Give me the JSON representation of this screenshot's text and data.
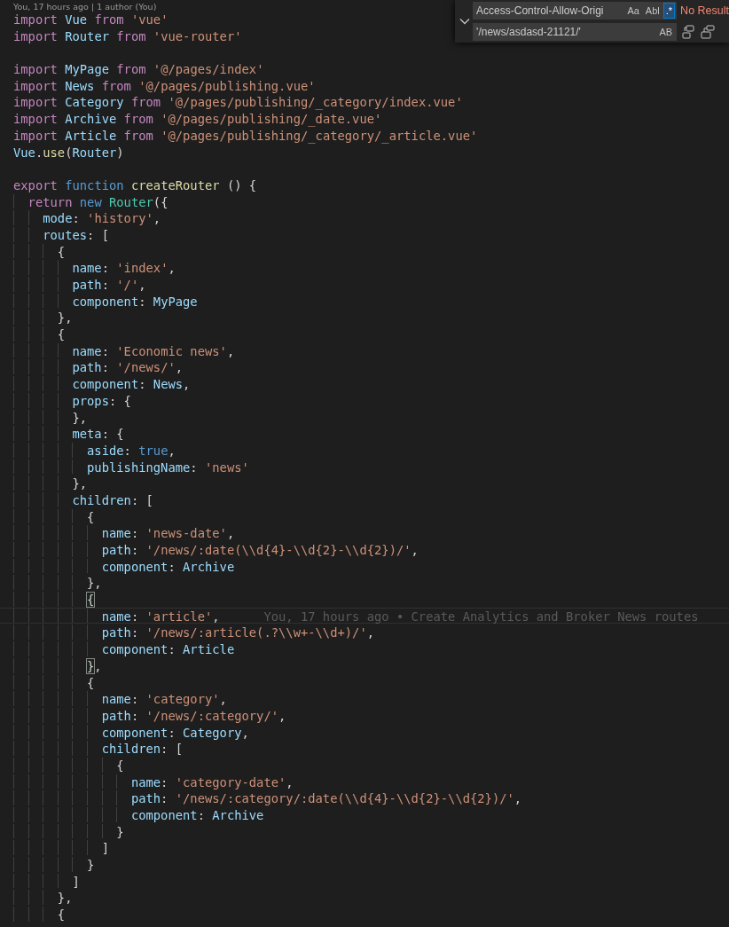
{
  "codelens": "You, 17 hours ago | 1 author (You)",
  "lines": [
    {
      "kind": "code",
      "tokens": [
        {
          "kind": "keyword",
          "text": "import "
        },
        {
          "kind": "variable",
          "text": "Vue "
        },
        {
          "kind": "keyword",
          "text": "from "
        },
        {
          "kind": "string",
          "text": "'vue'"
        }
      ]
    },
    {
      "kind": "code",
      "tokens": [
        {
          "kind": "keyword",
          "text": "import "
        },
        {
          "kind": "variable",
          "text": "Router "
        },
        {
          "kind": "keyword",
          "text": "from "
        },
        {
          "kind": "string",
          "text": "'vue-router'"
        }
      ]
    },
    {
      "kind": "blank"
    },
    {
      "kind": "code",
      "tokens": [
        {
          "kind": "keyword",
          "text": "import "
        },
        {
          "kind": "variable",
          "text": "MyPage "
        },
        {
          "kind": "keyword",
          "text": "from "
        },
        {
          "kind": "string",
          "text": "'@/pages/index'"
        }
      ]
    },
    {
      "kind": "code",
      "tokens": [
        {
          "kind": "keyword",
          "text": "import "
        },
        {
          "kind": "variable",
          "text": "News "
        },
        {
          "kind": "keyword",
          "text": "from "
        },
        {
          "kind": "string",
          "text": "'@/pages/publishing.vue'"
        }
      ]
    },
    {
      "kind": "code",
      "tokens": [
        {
          "kind": "keyword",
          "text": "import "
        },
        {
          "kind": "variable",
          "text": "Category "
        },
        {
          "kind": "keyword",
          "text": "from "
        },
        {
          "kind": "string",
          "text": "'@/pages/publishing/_category/index.vue'"
        }
      ]
    },
    {
      "kind": "code",
      "tokens": [
        {
          "kind": "keyword",
          "text": "import "
        },
        {
          "kind": "variable",
          "text": "Archive "
        },
        {
          "kind": "keyword",
          "text": "from "
        },
        {
          "kind": "string",
          "text": "'@/pages/publishing/_date.vue'"
        }
      ]
    },
    {
      "kind": "code",
      "tokens": [
        {
          "kind": "keyword",
          "text": "import "
        },
        {
          "kind": "variable",
          "text": "Article "
        },
        {
          "kind": "keyword",
          "text": "from "
        },
        {
          "kind": "string",
          "text": "'@/pages/publishing/_category/_article.vue'"
        }
      ]
    },
    {
      "kind": "code",
      "tokens": [
        {
          "kind": "variable",
          "text": "Vue"
        },
        {
          "kind": "punctuation",
          "text": "."
        },
        {
          "kind": "function",
          "text": "use"
        },
        {
          "kind": "punctuation",
          "text": "("
        },
        {
          "kind": "variable",
          "text": "Router"
        },
        {
          "kind": "punctuation",
          "text": ")"
        }
      ]
    },
    {
      "kind": "blank"
    },
    {
      "kind": "code",
      "tokens": [
        {
          "kind": "keyword",
          "text": "export "
        },
        {
          "kind": "storage",
          "text": "function "
        },
        {
          "kind": "function",
          "text": "createRouter"
        },
        {
          "kind": "punctuation",
          "text": " () {"
        }
      ]
    },
    {
      "kind": "code",
      "tokens": [
        {
          "kind": "keyword",
          "text": "  return "
        },
        {
          "kind": "storage",
          "text": "new "
        },
        {
          "kind": "class",
          "text": "Router"
        },
        {
          "kind": "punctuation",
          "text": "({"
        }
      ]
    },
    {
      "kind": "code",
      "tokens": [
        {
          "kind": "variable",
          "text": "    mode"
        },
        {
          "kind": "punctuation",
          "text": ": "
        },
        {
          "kind": "string",
          "text": "'history'"
        },
        {
          "kind": "punctuation",
          "text": ","
        }
      ]
    },
    {
      "kind": "code",
      "tokens": [
        {
          "kind": "variable",
          "text": "    routes"
        },
        {
          "kind": "punctuation",
          "text": ": ["
        }
      ]
    },
    {
      "kind": "code",
      "tokens": [
        {
          "kind": "punctuation",
          "text": "      {"
        }
      ]
    },
    {
      "kind": "code",
      "tokens": [
        {
          "kind": "variable",
          "text": "        name"
        },
        {
          "kind": "punctuation",
          "text": ": "
        },
        {
          "kind": "string",
          "text": "'index'"
        },
        {
          "kind": "punctuation",
          "text": ","
        }
      ]
    },
    {
      "kind": "code",
      "tokens": [
        {
          "kind": "variable",
          "text": "        path"
        },
        {
          "kind": "punctuation",
          "text": ": "
        },
        {
          "kind": "string",
          "text": "'/'"
        },
        {
          "kind": "punctuation",
          "text": ","
        }
      ]
    },
    {
      "kind": "code",
      "tokens": [
        {
          "kind": "variable",
          "text": "        component"
        },
        {
          "kind": "punctuation",
          "text": ": "
        },
        {
          "kind": "variable",
          "text": "MyPage"
        }
      ]
    },
    {
      "kind": "code",
      "tokens": [
        {
          "kind": "punctuation",
          "text": "      },"
        }
      ]
    },
    {
      "kind": "code",
      "tokens": [
        {
          "kind": "punctuation",
          "text": "      {"
        }
      ]
    },
    {
      "kind": "code",
      "tokens": [
        {
          "kind": "variable",
          "text": "        name"
        },
        {
          "kind": "punctuation",
          "text": ": "
        },
        {
          "kind": "string",
          "text": "'Economic news'"
        },
        {
          "kind": "punctuation",
          "text": ","
        }
      ]
    },
    {
      "kind": "code",
      "tokens": [
        {
          "kind": "variable",
          "text": "        path"
        },
        {
          "kind": "punctuation",
          "text": ": "
        },
        {
          "kind": "string",
          "text": "'/news/'"
        },
        {
          "kind": "punctuation",
          "text": ","
        }
      ]
    },
    {
      "kind": "code",
      "tokens": [
        {
          "kind": "variable",
          "text": "        component"
        },
        {
          "kind": "punctuation",
          "text": ": "
        },
        {
          "kind": "variable",
          "text": "News"
        },
        {
          "kind": "punctuation",
          "text": ","
        }
      ]
    },
    {
      "kind": "code",
      "tokens": [
        {
          "kind": "variable",
          "text": "        props"
        },
        {
          "kind": "punctuation",
          "text": ": {"
        }
      ]
    },
    {
      "kind": "code",
      "tokens": [
        {
          "kind": "punctuation",
          "text": "        },"
        }
      ]
    },
    {
      "kind": "code",
      "tokens": [
        {
          "kind": "variable",
          "text": "        meta"
        },
        {
          "kind": "punctuation",
          "text": ": {"
        }
      ]
    },
    {
      "kind": "code",
      "tokens": [
        {
          "kind": "variable",
          "text": "          aside"
        },
        {
          "kind": "punctuation",
          "text": ": "
        },
        {
          "kind": "storage",
          "text": "true"
        },
        {
          "kind": "punctuation",
          "text": ","
        }
      ]
    },
    {
      "kind": "code",
      "tokens": [
        {
          "kind": "variable",
          "text": "          publishingName"
        },
        {
          "kind": "punctuation",
          "text": ": "
        },
        {
          "kind": "string",
          "text": "'news'"
        }
      ]
    },
    {
      "kind": "code",
      "tokens": [
        {
          "kind": "punctuation",
          "text": "        },"
        }
      ]
    },
    {
      "kind": "code",
      "tokens": [
        {
          "kind": "variable",
          "text": "        children"
        },
        {
          "kind": "punctuation",
          "text": ": ["
        }
      ]
    },
    {
      "kind": "code",
      "tokens": [
        {
          "kind": "punctuation",
          "text": "          {"
        }
      ]
    },
    {
      "kind": "code",
      "tokens": [
        {
          "kind": "variable",
          "text": "            name"
        },
        {
          "kind": "punctuation",
          "text": ": "
        },
        {
          "kind": "string",
          "text": "'news-date'"
        },
        {
          "kind": "punctuation",
          "text": ","
        }
      ]
    },
    {
      "kind": "code",
      "tokens": [
        {
          "kind": "variable",
          "text": "            path"
        },
        {
          "kind": "punctuation",
          "text": ": "
        },
        {
          "kind": "string",
          "text": "'/news/:date(\\\\d{4}-\\\\d{2}-\\\\d{2})/'"
        },
        {
          "kind": "punctuation",
          "text": ","
        }
      ]
    },
    {
      "kind": "code",
      "tokens": [
        {
          "kind": "variable",
          "text": "            component"
        },
        {
          "kind": "punctuation",
          "text": ": "
        },
        {
          "kind": "variable",
          "text": "Archive"
        }
      ]
    },
    {
      "kind": "code",
      "tokens": [
        {
          "kind": "punctuation",
          "text": "          },"
        }
      ]
    },
    {
      "kind": "code",
      "tokens": [
        {
          "kind": "punctuation",
          "text": "          {",
          "matched": true
        }
      ]
    },
    {
      "kind": "code",
      "current": true,
      "blame": "You, 17 hours ago • Create Analytics and Broker News routes",
      "tokens": [
        {
          "kind": "variable",
          "text": "            name"
        },
        {
          "kind": "punctuation",
          "text": ": "
        },
        {
          "kind": "string",
          "text": "'article'"
        },
        {
          "kind": "punctuation",
          "text": ","
        }
      ]
    },
    {
      "kind": "code",
      "tokens": [
        {
          "kind": "variable",
          "text": "            path"
        },
        {
          "kind": "punctuation",
          "text": ": "
        },
        {
          "kind": "string",
          "text": "'/news/:article(.?\\\\w+-\\\\d+)/'"
        },
        {
          "kind": "punctuation",
          "text": ","
        }
      ]
    },
    {
      "kind": "code",
      "tokens": [
        {
          "kind": "variable",
          "text": "            component"
        },
        {
          "kind": "punctuation",
          "text": ": "
        },
        {
          "kind": "variable",
          "text": "Article"
        }
      ]
    },
    {
      "kind": "code",
      "tokens": [
        {
          "kind": "punctuation",
          "text": "          }",
          "matched": true
        },
        {
          "kind": "punctuation",
          "text": ","
        }
      ]
    },
    {
      "kind": "code",
      "tokens": [
        {
          "kind": "punctuation",
          "text": "          {"
        }
      ]
    },
    {
      "kind": "code",
      "tokens": [
        {
          "kind": "variable",
          "text": "            name"
        },
        {
          "kind": "punctuation",
          "text": ": "
        },
        {
          "kind": "string",
          "text": "'category'"
        },
        {
          "kind": "punctuation",
          "text": ","
        }
      ]
    },
    {
      "kind": "code",
      "tokens": [
        {
          "kind": "variable",
          "text": "            path"
        },
        {
          "kind": "punctuation",
          "text": ": "
        },
        {
          "kind": "string",
          "text": "'/news/:category/'"
        },
        {
          "kind": "punctuation",
          "text": ","
        }
      ]
    },
    {
      "kind": "code",
      "tokens": [
        {
          "kind": "variable",
          "text": "            component"
        },
        {
          "kind": "punctuation",
          "text": ": "
        },
        {
          "kind": "variable",
          "text": "Category"
        },
        {
          "kind": "punctuation",
          "text": ","
        }
      ]
    },
    {
      "kind": "code",
      "tokens": [
        {
          "kind": "variable",
          "text": "            children"
        },
        {
          "kind": "punctuation",
          "text": ": ["
        }
      ]
    },
    {
      "kind": "code",
      "tokens": [
        {
          "kind": "punctuation",
          "text": "              {"
        }
      ]
    },
    {
      "kind": "code",
      "tokens": [
        {
          "kind": "variable",
          "text": "                name"
        },
        {
          "kind": "punctuation",
          "text": ": "
        },
        {
          "kind": "string",
          "text": "'category-date'"
        },
        {
          "kind": "punctuation",
          "text": ","
        }
      ]
    },
    {
      "kind": "code",
      "tokens": [
        {
          "kind": "variable",
          "text": "                path"
        },
        {
          "kind": "punctuation",
          "text": ": "
        },
        {
          "kind": "string",
          "text": "'/news/:category/:date(\\\\d{4}-\\\\d{2}-\\\\d{2})/'"
        },
        {
          "kind": "punctuation",
          "text": ","
        }
      ]
    },
    {
      "kind": "code",
      "tokens": [
        {
          "kind": "variable",
          "text": "                component"
        },
        {
          "kind": "punctuation",
          "text": ": "
        },
        {
          "kind": "variable",
          "text": "Archive"
        }
      ]
    },
    {
      "kind": "code",
      "tokens": [
        {
          "kind": "punctuation",
          "text": "              }"
        }
      ]
    },
    {
      "kind": "code",
      "tokens": [
        {
          "kind": "punctuation",
          "text": "            ]"
        }
      ]
    },
    {
      "kind": "code",
      "tokens": [
        {
          "kind": "punctuation",
          "text": "          }"
        }
      ]
    },
    {
      "kind": "code",
      "tokens": [
        {
          "kind": "punctuation",
          "text": "        ]"
        }
      ]
    },
    {
      "kind": "code",
      "tokens": [
        {
          "kind": "punctuation",
          "text": "      },"
        }
      ]
    },
    {
      "kind": "code",
      "tokens": [
        {
          "kind": "punctuation",
          "text": "      {"
        }
      ]
    }
  ],
  "find_widget": {
    "expanded": true,
    "find_value": "Access-Control-Allow-Origi",
    "find_options": [
      {
        "label": "Aa",
        "selected": false
      },
      {
        "label": "Abl",
        "selected": false
      },
      {
        "label": ".*",
        "selected": true
      }
    ],
    "result": "No Result",
    "replace_value": "'/news/asdasd-21121/'",
    "replace_options": [
      {
        "label": "AB",
        "selected": false
      }
    ]
  }
}
